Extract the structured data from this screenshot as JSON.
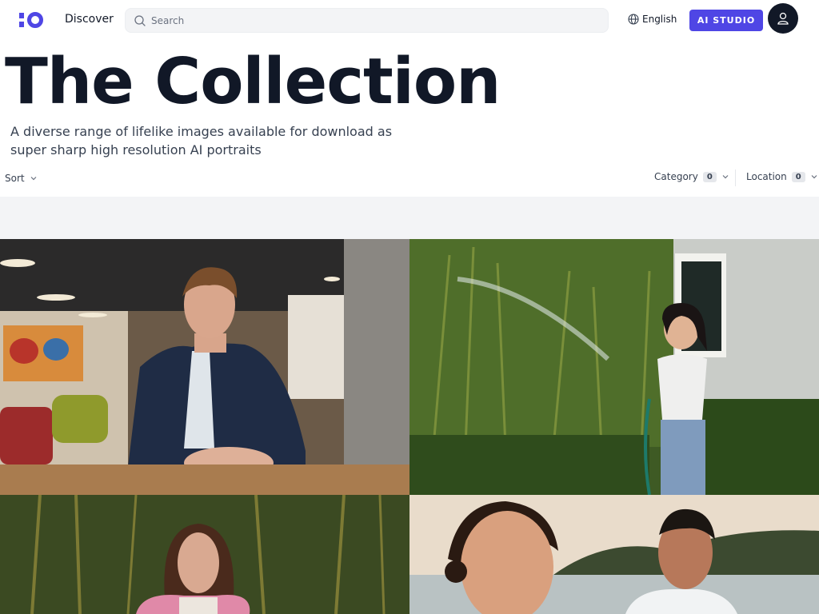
{
  "header": {
    "nav_discover": "Discover",
    "search_placeholder": "Search",
    "language": "English",
    "studio_button": "AI STUDIO"
  },
  "hero": {
    "title": "The Collection",
    "subtitle": "A diverse range of lifelike images available for download as super sharp high resolution AI portraits"
  },
  "filters": {
    "sort_label": "Sort",
    "category_label": "Category",
    "category_count": "0",
    "location_label": "Location",
    "location_count": "0"
  },
  "colors": {
    "accent": "#4f46e5",
    "text": "#111827",
    "band": "#f3f4f6"
  },
  "gallery": [
    {
      "subject": "man in blazer at office table"
    },
    {
      "subject": "woman watering bamboo with hose"
    },
    {
      "subject": "woman in pink jacket among bamboo"
    },
    {
      "subject": "smiling couple by the sea at sunset"
    }
  ]
}
